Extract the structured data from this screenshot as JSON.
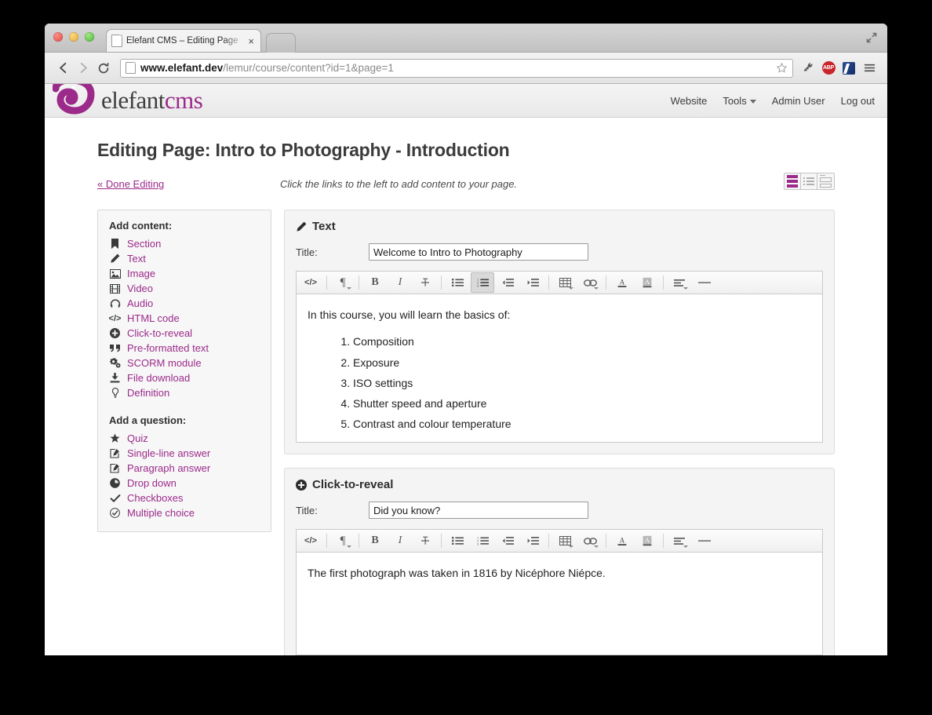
{
  "browser": {
    "tab_title": "Elefant CMS – Editing Page",
    "close_label": "×",
    "url_domain": "www.elefant.dev",
    "url_path": "/lemur/course/content?id=1&page=1",
    "back_icon": "back-arrow-icon",
    "forward_icon": "forward-arrow-icon",
    "reload_icon": "reload-icon",
    "star_icon": "bookmark-star-icon",
    "extensions": [
      "wrench-icon",
      "ABP",
      "blue-extension-icon"
    ],
    "menu_icon": "hamburger-menu-icon"
  },
  "site": {
    "logo_text_primary": "elefant",
    "logo_text_accent": "cms",
    "accent_color": "#9b2a8a",
    "nav": [
      {
        "label": "Website",
        "has_caret": false
      },
      {
        "label": "Tools",
        "has_caret": true
      },
      {
        "label": "Admin User",
        "has_caret": false
      },
      {
        "label": "Log out",
        "has_caret": false
      }
    ]
  },
  "page": {
    "title": "Editing Page: Intro to Photography - Introduction",
    "done_editing": "« Done Editing",
    "hint": "Click the links to the left to add content to your page.",
    "layout_buttons": [
      {
        "name": "layout-single-column",
        "active": true
      },
      {
        "name": "layout-list",
        "active": false
      },
      {
        "name": "layout-boxes",
        "active": false
      }
    ]
  },
  "sidebar": {
    "add_content_heading": "Add content:",
    "content_items": [
      {
        "label": "Section",
        "icon": "bookmark-icon"
      },
      {
        "label": "Text",
        "icon": "pencil-icon"
      },
      {
        "label": "Image",
        "icon": "image-icon"
      },
      {
        "label": "Video",
        "icon": "film-icon"
      },
      {
        "label": "Audio",
        "icon": "headphones-icon"
      },
      {
        "label": "HTML code",
        "icon": "code-icon"
      },
      {
        "label": "Click-to-reveal",
        "icon": "plus-circle-icon"
      },
      {
        "label": "Pre-formatted text",
        "icon": "quote-icon"
      },
      {
        "label": "SCORM module",
        "icon": "gears-icon"
      },
      {
        "label": "File download",
        "icon": "download-icon"
      },
      {
        "label": "Definition",
        "icon": "lightbulb-icon"
      }
    ],
    "add_question_heading": "Add a question:",
    "question_items": [
      {
        "label": "Quiz",
        "icon": "star-icon"
      },
      {
        "label": "Single-line answer",
        "icon": "edit-square-icon"
      },
      {
        "label": "Paragraph answer",
        "icon": "edit-square-icon"
      },
      {
        "label": "Drop down",
        "icon": "dropdown-circle-icon"
      },
      {
        "label": "Checkboxes",
        "icon": "check-icon"
      },
      {
        "label": "Multiple choice",
        "icon": "check-circle-icon"
      }
    ]
  },
  "toolbar_buttons": [
    {
      "name": "source-code-button",
      "glyph": "</>",
      "caret": false
    },
    {
      "sep": true
    },
    {
      "name": "paragraph-format-button",
      "glyph": "¶",
      "caret": true
    },
    {
      "sep": true
    },
    {
      "name": "bold-button",
      "glyph": "B",
      "caret": false
    },
    {
      "name": "italic-button",
      "glyph": "I",
      "caret": false
    },
    {
      "name": "strikethrough-button",
      "glyph": "S",
      "caret": false
    },
    {
      "sep": true
    },
    {
      "name": "unordered-list-button",
      "glyph": "ul",
      "caret": false
    },
    {
      "name": "ordered-list-button",
      "glyph": "ol",
      "caret": false
    },
    {
      "name": "outdent-button",
      "glyph": "outdent",
      "caret": false
    },
    {
      "name": "indent-button",
      "glyph": "indent",
      "caret": false
    },
    {
      "sep": true
    },
    {
      "name": "insert-table-button",
      "glyph": "table",
      "caret": true
    },
    {
      "name": "insert-link-button",
      "glyph": "link",
      "caret": true
    },
    {
      "sep": true
    },
    {
      "name": "font-color-button",
      "glyph": "A",
      "caret": false
    },
    {
      "name": "background-color-button",
      "glyph": "A-bg",
      "caret": false
    },
    {
      "sep": true
    },
    {
      "name": "align-button",
      "glyph": "align",
      "caret": true
    },
    {
      "name": "horizontal-rule-button",
      "glyph": "hr",
      "caret": false
    }
  ],
  "panels": [
    {
      "type": "text",
      "heading": "Text",
      "icon": "pencil-icon",
      "title_label": "Title:",
      "title_value": "Welcome to Intro to Photography",
      "active_toolbar_button": "ordered-list-button",
      "body_intro": "In this course, you will learn the basics of:",
      "body_list": [
        "Composition",
        "Exposure",
        "ISO settings",
        "Shutter speed and aperture",
        "Contrast and colour temperature"
      ]
    },
    {
      "type": "click-to-reveal",
      "heading": "Click-to-reveal",
      "icon": "plus-circle-icon",
      "title_label": "Title:",
      "title_value": "Did you know?",
      "active_toolbar_button": "",
      "body_intro": "The first photograph was taken in 1816 by Nicéphore Niépce.",
      "body_list": []
    }
  ]
}
